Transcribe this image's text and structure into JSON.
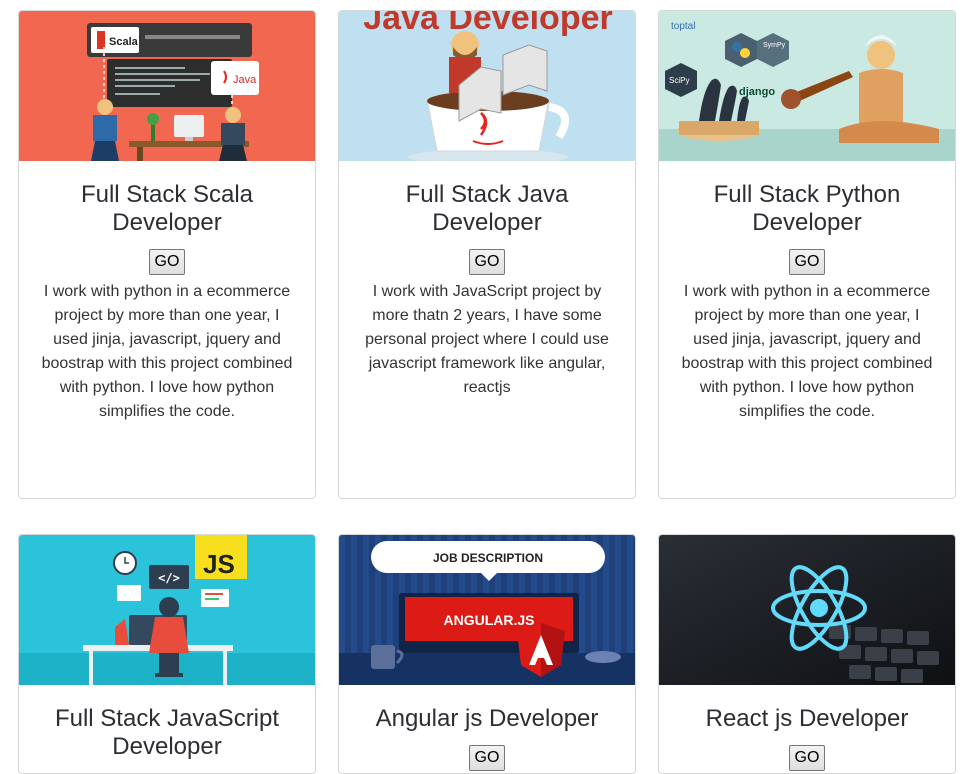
{
  "cards": [
    {
      "title": "Full Stack Scala Developer",
      "button": "GO",
      "description": "I work with python in a ecommerce project by more than one year, I used jinja, javascript, jquery and boostrap with this project combined with python. I love how python simplifies the code.",
      "image": {
        "bg": "#f2674f",
        "labels": [
          "Scala",
          "Java"
        ]
      }
    },
    {
      "title": "Full Stack Java Developer",
      "button": "GO",
      "description": "I work with JavaScript project by more thatn 2 years, I have some personal project where I could use javascript framework like angular, reactjs",
      "image": {
        "bg": "#bfe0f0",
        "labels": [
          "Java Developer"
        ]
      }
    },
    {
      "title": "Full Stack Python Developer",
      "button": "GO",
      "description": "I work with python in a ecommerce project by more than one year, I used jinja, javascript, jquery and boostrap with this project combined with python. I love how python simplifies the code.",
      "image": {
        "bg": "#c9e9e2",
        "labels": [
          "toptal",
          "SciPy",
          "django",
          "SymPy"
        ]
      }
    },
    {
      "title": "Full Stack JavaScript Developer",
      "button": "GO",
      "description": "",
      "image": {
        "bg": "#2bc3d9",
        "labels": [
          "JS",
          "</>"
        ]
      }
    },
    {
      "title": "Angular js Developer",
      "button": "GO",
      "description": "",
      "image": {
        "bg": "#1e3f78",
        "labels": [
          "JOB DESCRIPTION",
          "ANGULAR.JS"
        ]
      }
    },
    {
      "title": "React js Developer",
      "button": "GO",
      "description": "",
      "image": {
        "bg": "#1b1f24",
        "labels": []
      }
    }
  ],
  "colors": {
    "scala_red": "#f2674f",
    "java_sky": "#bfe0f0",
    "python_mint": "#c9e9e2",
    "js_cyan": "#2bc3d9",
    "angular_navy": "#1e3f78",
    "angular_red": "#dd1b16",
    "react_blue": "#61dafb"
  }
}
